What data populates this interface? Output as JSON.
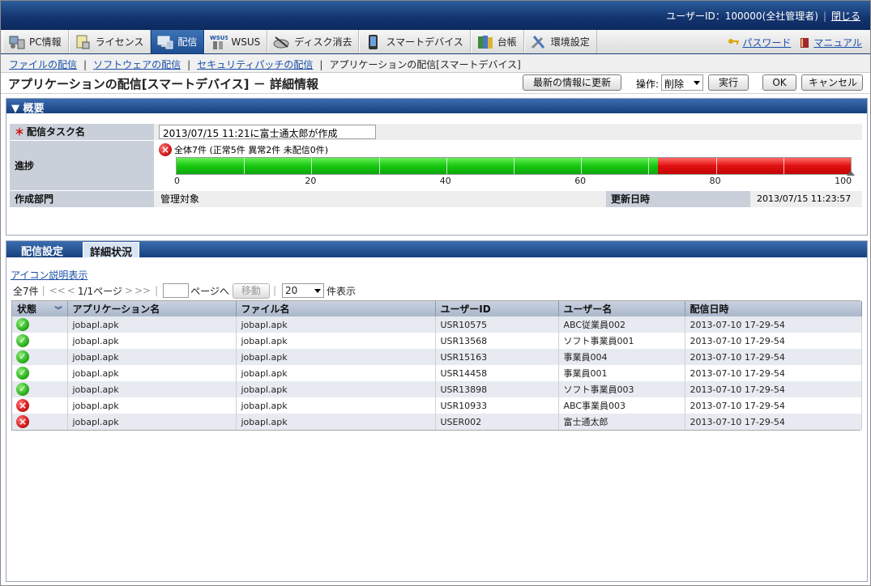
{
  "header": {
    "user_label": "ユーザーID：100000(全社管理者)",
    "logout": "閉じる"
  },
  "mainnav": {
    "tabs": [
      {
        "label": "PC情報",
        "icon": "pc-info-icon"
      },
      {
        "label": "ライセンス",
        "icon": "license-icon"
      },
      {
        "label": "配信",
        "icon": "distribution-icon",
        "active": true
      },
      {
        "label": "WSUS",
        "icon": "wsus-icon",
        "badge": "WSUS"
      },
      {
        "label": "ディスク消去",
        "icon": "disk-erase-icon"
      },
      {
        "label": "スマートデバイス",
        "icon": "smart-device-icon"
      },
      {
        "label": "台帳",
        "icon": "ledger-icon"
      },
      {
        "label": "環境設定",
        "icon": "settings-icon"
      }
    ],
    "password": "パスワード",
    "manual": "マニュアル"
  },
  "subnav": {
    "links": [
      "ファイルの配信",
      "ソフトウェアの配信",
      "セキュリティパッチの配信"
    ],
    "current": "アプリケーションの配信[スマートデバイス]"
  },
  "titlebar": {
    "title": "アプリケーションの配信[スマートデバイス] － 詳細情報",
    "refresh": "最新の情報に更新",
    "operation_label": "操作:",
    "operation_value": "削除",
    "execute": "実行",
    "ok": "OK",
    "cancel": "キャンセル"
  },
  "overview": {
    "header": "▼ 概要",
    "task_label": "配信タスク名",
    "required_mark": "＊",
    "task_name": "2013/07/15 11:21に富士通太郎が作成",
    "progress_label": "進捗",
    "progress_summary": "全体7件 (正常5件 異常2件 未配信0件)",
    "dept_label": "作成部門",
    "dept_value": "管理対象",
    "updated_label": "更新日時",
    "updated_value": "2013/07/15 11:23:57"
  },
  "progress": {
    "total": 7,
    "normal": 5,
    "error": 2,
    "undelivered": 0,
    "ticks": [
      "0",
      "20",
      "40",
      "60",
      "80",
      "100"
    ],
    "colors": {
      "normal": "#18c80f",
      "error": "#e01010"
    }
  },
  "detail": {
    "tabs": [
      "配信設定",
      "詳細状況"
    ],
    "active_tab": 1,
    "legend_link": "アイコン説明表示",
    "pager": {
      "total": "全7件",
      "first": "<<",
      "prev": "<",
      "page_info": "1/1ページ",
      "next": ">",
      "last": ">>",
      "page_suffix": "ページへ",
      "go": "移動",
      "per_page": "20",
      "per_page_suffix": "件表示"
    },
    "columns": [
      "状態",
      "アプリケーション名",
      "ファイル名",
      "ユーザーID",
      "ユーザー名",
      "配信日時"
    ],
    "rows": [
      {
        "status": "ok",
        "app": "jobapl.apk",
        "file": "jobapl.apk",
        "user_id": "USR10575",
        "user_name": "ABC従業員002",
        "date": "2013-07-10 17-29-54"
      },
      {
        "status": "ok",
        "app": "jobapl.apk",
        "file": "jobapl.apk",
        "user_id": "USR13568",
        "user_name": "ソフト事業員001",
        "date": "2013-07-10 17-29-54"
      },
      {
        "status": "ok",
        "app": "jobapl.apk",
        "file": "jobapl.apk",
        "user_id": "USR15163",
        "user_name": "事業員004",
        "date": "2013-07-10 17-29-54"
      },
      {
        "status": "ok",
        "app": "jobapl.apk",
        "file": "jobapl.apk",
        "user_id": "USR14458",
        "user_name": "事業員001",
        "date": "2013-07-10 17-29-54"
      },
      {
        "status": "ok",
        "app": "jobapl.apk",
        "file": "jobapl.apk",
        "user_id": "USR13898",
        "user_name": "ソフト事業員003",
        "date": "2013-07-10 17-29-54"
      },
      {
        "status": "error",
        "app": "jobapl.apk",
        "file": "jobapl.apk",
        "user_id": "USR10933",
        "user_name": "ABC事業員003",
        "date": "2013-07-10 17-29-54"
      },
      {
        "status": "error",
        "app": "jobapl.apk",
        "file": "jobapl.apk",
        "user_id": "USER002",
        "user_name": "富士通太郎",
        "date": "2013-07-10 17-29-54"
      }
    ]
  }
}
